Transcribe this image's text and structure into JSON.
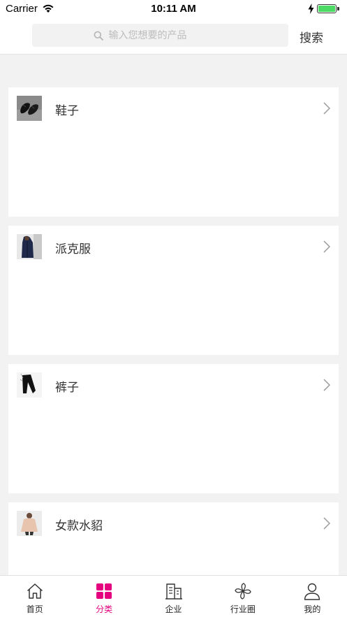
{
  "status_bar": {
    "carrier": "Carrier",
    "time": "10:11 AM",
    "battery_level": 1.0
  },
  "search": {
    "placeholder": "输入您想要的产品",
    "value": "",
    "button_label": "搜索"
  },
  "categories": [
    {
      "title": "鞋子",
      "thumb_icon": "shoes-photo"
    },
    {
      "title": "派克服",
      "thumb_icon": "parka-photo"
    },
    {
      "title": "裤子",
      "thumb_icon": "pants-photo"
    },
    {
      "title": "女款水貂",
      "thumb_icon": "mink-coat-photo"
    }
  ],
  "tabs": [
    {
      "label": "首页",
      "icon": "home-icon",
      "active": false
    },
    {
      "label": "分类",
      "icon": "category-grid-icon",
      "active": true
    },
    {
      "label": "企业",
      "icon": "building-icon",
      "active": false
    },
    {
      "label": "行业圈",
      "icon": "pinwheel-icon",
      "active": false
    },
    {
      "label": "我的",
      "icon": "user-icon",
      "active": false
    }
  ],
  "colors": {
    "accent": "#e4007f",
    "background": "#f2f2f2",
    "battery": "#4cd964"
  }
}
